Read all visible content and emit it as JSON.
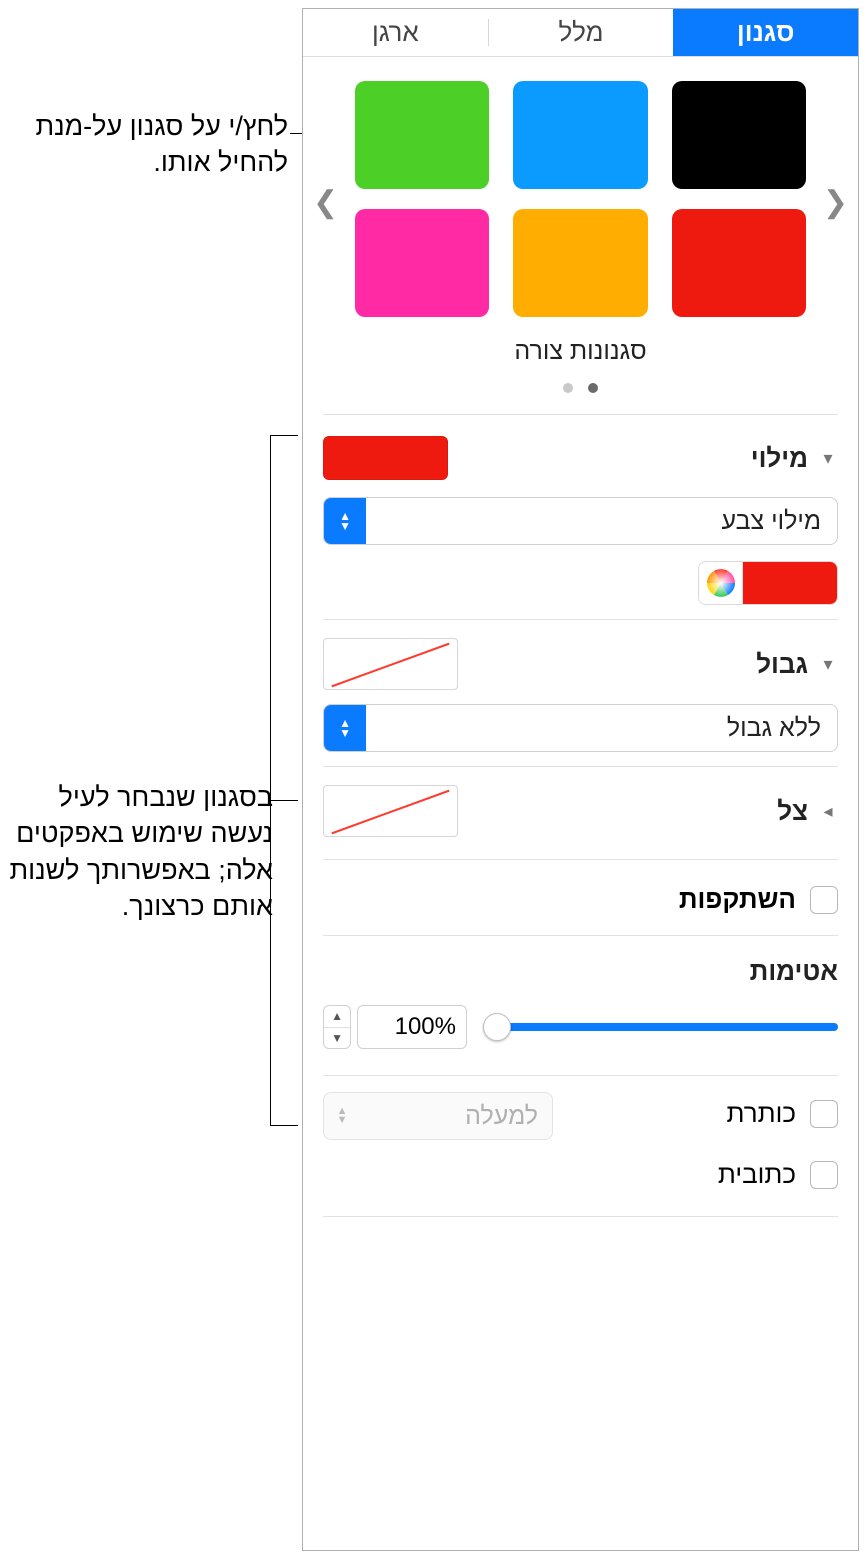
{
  "callouts": {
    "top": "לחץ/י על סגנון על-מנת להחיל אותו.",
    "side": "בסגנון שנבחר לעיל נעשה שימוש באפקטים אלה; באפשרותך לשנות אותם כרצונך."
  },
  "tabs": {
    "style": "סגנון",
    "text": "מלל",
    "arrange": "ארגן"
  },
  "styles": {
    "caption": "סגנונות צורה",
    "swatches": [
      "#000000",
      "#0b9bff",
      "#4ccf27",
      "#ef1a0f",
      "#ffad00",
      "#ff2aa4"
    ]
  },
  "fill": {
    "title": "מילוי",
    "swatch_color": "#ef1a0f",
    "type_label": "מילוי צבע",
    "picker_color": "#ef1a0f"
  },
  "border": {
    "title": "גבול",
    "type_label": "ללא גבול"
  },
  "shadow": {
    "title": "צל"
  },
  "reflection": {
    "label": "השתקפות"
  },
  "opacity": {
    "title": "אטימות",
    "value": "100%"
  },
  "titlesub": {
    "title_label": "כותרת",
    "subtitle_label": "כתובית",
    "position_label": "למעלה"
  }
}
